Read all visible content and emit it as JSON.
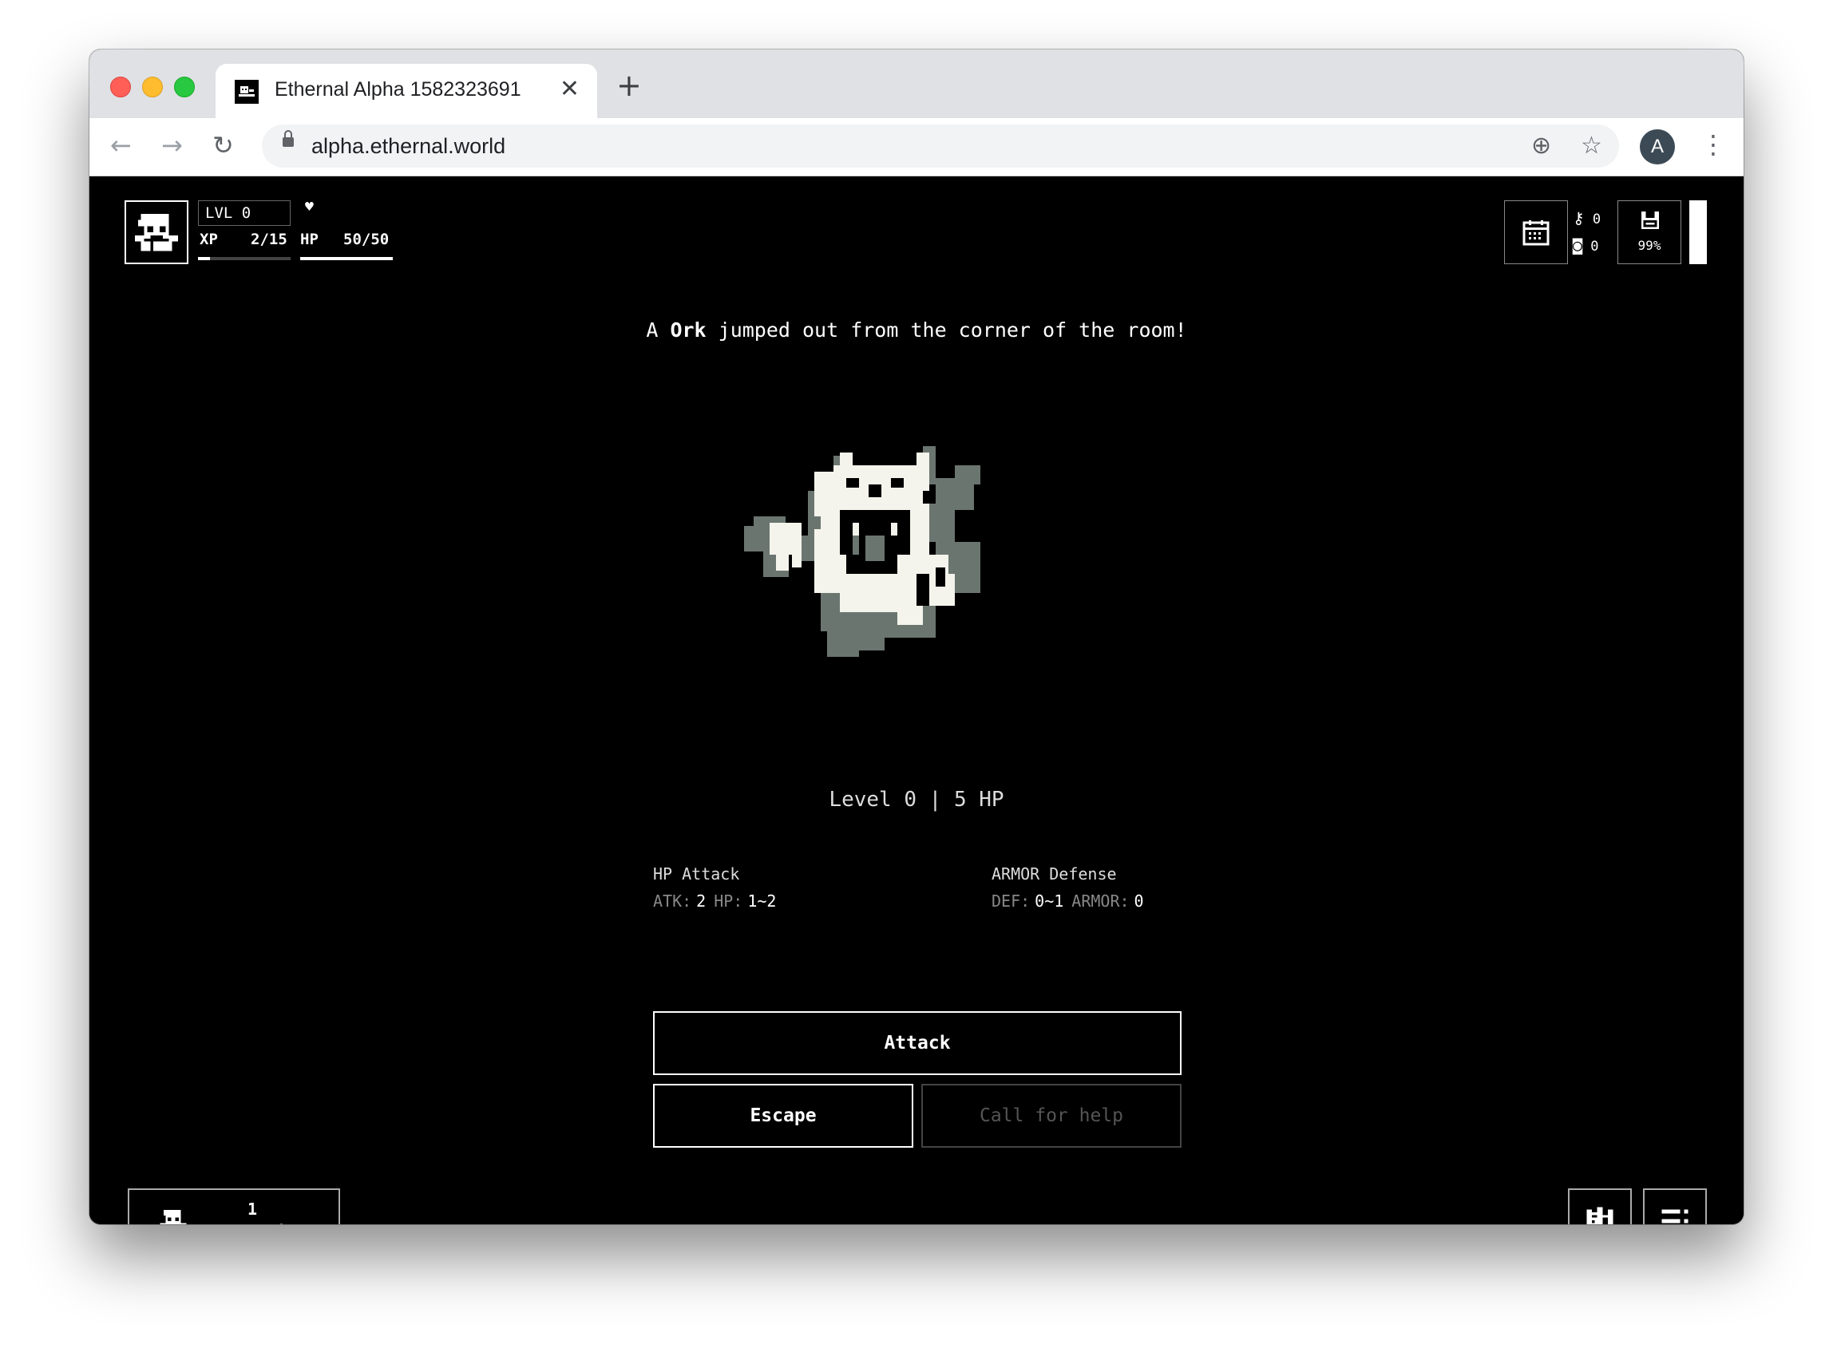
{
  "browser": {
    "tab_title": "Ethernal Alpha 1582323691",
    "tab_close": "✕",
    "new_tab": "+",
    "url": "alpha.ethernal.world",
    "avatar_letter": "A",
    "icons": [
      "close-window-icon",
      "minimize-icon",
      "maximize-icon",
      "favicon-icon",
      "back-icon",
      "forward-icon",
      "reload-icon",
      "lock-icon",
      "install-icon",
      "bookmark-star-icon",
      "menu-kebab-icon"
    ]
  },
  "hud": {
    "level_label": "LVL 0",
    "xp_label": "XP",
    "xp_value": "2/15",
    "xp_fraction": 0.13,
    "hp_label": "HP",
    "hp_value": "50/50",
    "hp_fraction": 1.0,
    "keys_count": "0",
    "coins_count": "0",
    "save_percent": "99%"
  },
  "encounter": {
    "message_pre": "A ",
    "monster_name": "Ork",
    "message_post": " jumped out from the corner of the room!",
    "enemy_level": "Level 0 | 5 HP",
    "attack_title": "HP Attack",
    "atk_label": "ATK:",
    "atk_value": "2",
    "hp_label": "HP:",
    "hp_value": "1~2",
    "defense_title": "ARMOR Defense",
    "def_label": "DEF:",
    "def_value": "0~1",
    "armor_label": "ARMOR:",
    "armor_value": "0"
  },
  "actions": {
    "attack": "Attack",
    "escape": "Escape",
    "call_for_help": "Call for help"
  },
  "footer": {
    "online_count": "1",
    "online_label": "online"
  },
  "colors": {
    "background": "#000000",
    "foreground": "#ffffff",
    "monster_light": "#f4f4ec",
    "monster_dark": "#6b7570",
    "disabled": "#555555"
  }
}
